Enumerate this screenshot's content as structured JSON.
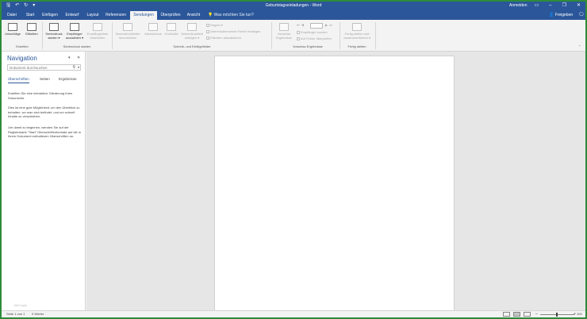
{
  "window": {
    "title": "Geburtstagseinladungen - Word",
    "login": "Anmelden",
    "quick_access": [
      "save-icon",
      "undo-icon",
      "redo-icon",
      "customize-icon"
    ],
    "controls": [
      "ribbon-display-icon",
      "minimize-icon",
      "maximize-icon",
      "close-icon"
    ]
  },
  "tabs": [
    {
      "label": "Datei"
    },
    {
      "label": "Start"
    },
    {
      "label": "Einfügen"
    },
    {
      "label": "Entwurf"
    },
    {
      "label": "Layout"
    },
    {
      "label": "Referenzen"
    },
    {
      "label": "Sendungen",
      "active": true
    },
    {
      "label": "Überprüfen"
    },
    {
      "label": "Ansicht"
    }
  ],
  "tell_me": "Was möchten Sie tun?",
  "share": "Freigeben",
  "ribbon": {
    "groups": [
      {
        "label": "Erstellen",
        "buttons": [
          "Umschläge",
          "Etiketten"
        ]
      },
      {
        "label": "Seriendruck starten",
        "buttons": [
          "Seriendruck starten ▾",
          "Empfänger auswählen ▾",
          "Empfängerliste bearbeiten"
        ]
      },
      {
        "label": "Schreib- und Einfügefelder",
        "buttons": [
          "Seriendruckfelder hervorheben",
          "Adressblock",
          "Grußzeile",
          "Seriendruckfeld einfügen ▾"
        ],
        "small": [
          "Regeln ▾",
          "Übereinstimmende Felder festlegen",
          "Etiketten aktualisieren"
        ]
      },
      {
        "label": "Vorschau Ergebnisse",
        "buttons": [
          "Vorschau Ergebnisse"
        ],
        "small": [
          "Empfänger suchen",
          "Auf Fehler überprüfen"
        ]
      },
      {
        "label": "Fertig stellen",
        "buttons": [
          "Fertig stellen und zusammenführen ▾"
        ]
      }
    ]
  },
  "nav": {
    "title": "Navigation",
    "search_placeholder": "Dokument durchsuchen",
    "tabs": [
      "Überschriften",
      "Seiten",
      "Ergebnisse"
    ],
    "paragraphs": [
      "Erstellen Sie eine interaktive Gliederung Ihres Dokuments.",
      "Dies ist eine gute Möglichkeit, um den Überblick zu behalten, wo man sich befindet, und um schnell Inhalte zu verschieben.",
      "Um damit zu beginnen, wenden Sie auf der Registerkarte \"Start\" Überschriftenformate auf die in Ihrem Dokument enthaltenen Überschriften an."
    ],
    "footer": "Mei login"
  },
  "status": {
    "page": "Seite 1 von 1",
    "words": "0 Wörter",
    "zoom": "100 %",
    "zoom_fraction": 0.5
  },
  "colors": {
    "accent": "#2b579a",
    "frame": "#2e8b3a"
  }
}
